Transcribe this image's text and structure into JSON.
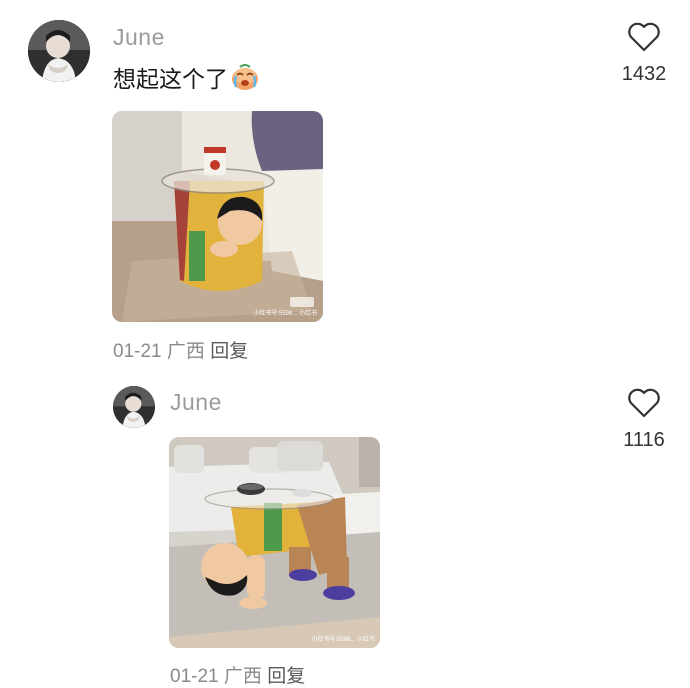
{
  "comments": [
    {
      "username": "June",
      "text": "想起这个了",
      "emoji": "crying-face-emoji",
      "likes": "1432",
      "date": "01-21",
      "location": "广西",
      "reply_label": "回复",
      "image": {
        "watermark": "小红书号:5598... 小红书"
      }
    },
    {
      "username": "June",
      "likes": "1116",
      "date": "01-21",
      "location": "广西",
      "reply_label": "回复",
      "image": {
        "watermark": "小红书号:5598... 小红书"
      }
    }
  ]
}
